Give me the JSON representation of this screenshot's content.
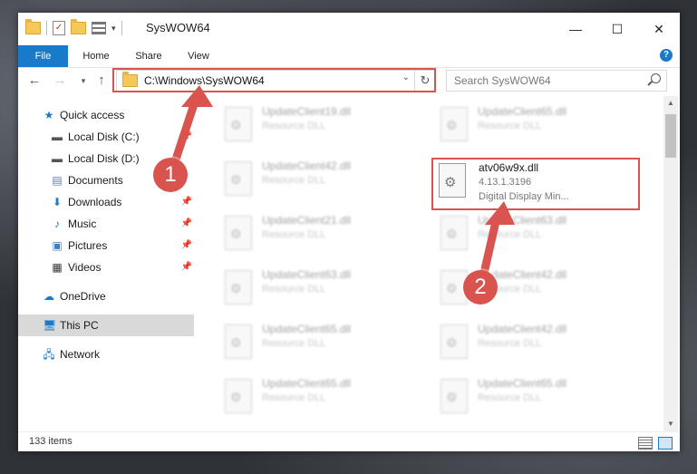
{
  "window": {
    "title": "SysWOW64",
    "controls": {
      "minimize": "—",
      "maximize": "☐",
      "close": "✕"
    }
  },
  "ribbon": {
    "tabs": [
      "File",
      "Home",
      "Share",
      "View"
    ],
    "help": "?"
  },
  "navigation": {
    "address_path": "C:\\Windows\\SysWOW64",
    "search_placeholder": "Search SysWOW64"
  },
  "sidebar": {
    "items": [
      {
        "label": "Quick access",
        "icon": "star-icon"
      },
      {
        "label": "Local Disk (C:)",
        "icon": "drive-icon"
      },
      {
        "label": "Local Disk (D:)",
        "icon": "drive-icon"
      },
      {
        "label": "Documents",
        "icon": "documents-icon"
      },
      {
        "label": "Downloads",
        "icon": "download-icon"
      },
      {
        "label": "Music",
        "icon": "music-icon"
      },
      {
        "label": "Pictures",
        "icon": "pictures-icon"
      },
      {
        "label": "Videos",
        "icon": "videos-icon"
      },
      {
        "label": "OneDrive",
        "icon": "cloud-icon"
      },
      {
        "label": "This PC",
        "icon": "computer-icon"
      },
      {
        "label": "Network",
        "icon": "network-icon"
      }
    ]
  },
  "files": {
    "blurred": [
      {
        "name": "UpdateClient19.dll",
        "desc": "Resource DLL"
      },
      {
        "name": "UpdateClient65.dll",
        "desc": "Resource DLL"
      },
      {
        "name": "UpdateClient42.dll",
        "desc": "Resource DLL"
      },
      {
        "name": "UpdateClient21.dll",
        "desc": "Resource DLL"
      },
      {
        "name": "UpdateClient63.dll",
        "desc": "Resource DLL"
      },
      {
        "name": "UpdateClient63.dll",
        "desc": "Resource DLL"
      },
      {
        "name": "UpdateClient42.dll",
        "desc": "Resource DLL"
      },
      {
        "name": "UpdateClient65.dll",
        "desc": "Resource DLL"
      },
      {
        "name": "UpdateClient42.dll",
        "desc": "Resource DLL"
      },
      {
        "name": "UpdateClient65.dll",
        "desc": "Resource DLL"
      },
      {
        "name": "UpdateClient65.dll",
        "desc": "Resource DLL"
      }
    ],
    "highlighted": {
      "name": "atv06w9x.dll",
      "version": "4.13.1.3196",
      "description": "Digital Display Min..."
    }
  },
  "status": {
    "item_count": "133 items"
  },
  "annotations": {
    "step1": "1",
    "step2": "2"
  },
  "colors": {
    "accent": "#1979ca",
    "highlight": "#d9534f"
  }
}
